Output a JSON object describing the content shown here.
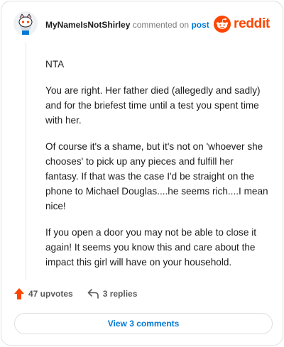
{
  "comment": {
    "username": "MyNameIsNotShirley",
    "action": "commented on",
    "post_link": "post",
    "paragraphs": [
      "NTA",
      "You are right. Her father died (allegedly and sadly) and for the briefest time until a test you spent time with her.",
      "Of course it's a shame, but it's not on 'whoever she chooses' to pick up any pieces and fulfill her fantasy. If that was the case I'd be straight on the phone to Michael Douglas....he seems rich....I mean nice!",
      "If you open a door you may not be able to close it again! It seems you know this and care about the impact this girl will have on your household."
    ]
  },
  "brand": {
    "name": "reddit",
    "icon": "reddit-icon",
    "color": "#ff4500"
  },
  "footer": {
    "upvotes": "47 upvotes",
    "replies": "3 replies",
    "upvote_icon": "upvote-arrow-icon",
    "reply_icon": "reply-icon",
    "upvote_color": "#ff4500"
  },
  "view_comments": {
    "label": "View 3 comments",
    "color": "#0079d3"
  }
}
